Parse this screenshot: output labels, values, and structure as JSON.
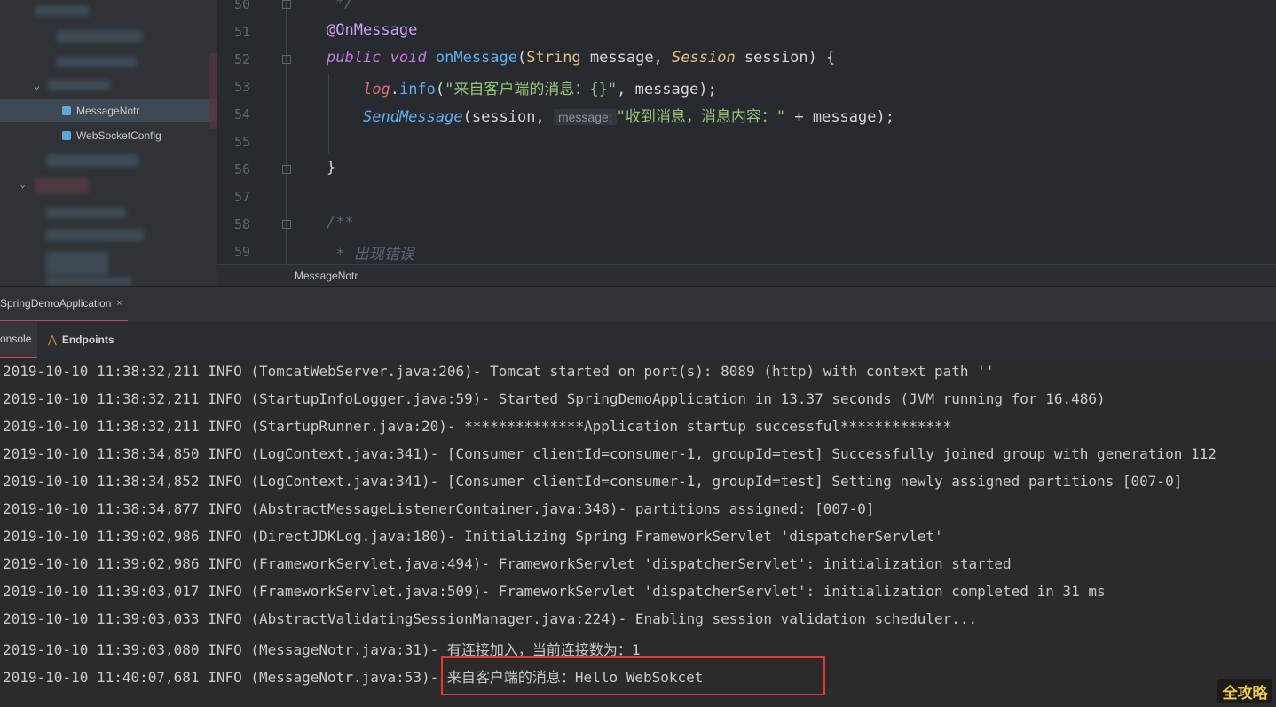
{
  "project_tree": {
    "items": [
      {
        "label": "MessageNotr",
        "selected": true
      },
      {
        "label": "WebSocketConfig",
        "selected": false
      }
    ]
  },
  "editor": {
    "line_numbers": [
      "50",
      "51",
      "52",
      "53",
      "54",
      "55",
      "56",
      "57",
      "58",
      "59"
    ],
    "lines": {
      "l50": "*/",
      "l51_annotation": "@OnMessage",
      "l52_kw1": "public",
      "l52_kw2": "void",
      "l52_fn": "onMessage",
      "l52_type1": "String",
      "l52_p1": " message, ",
      "l52_type2": "Session",
      "l52_p2": " session) {",
      "l53_var": "log",
      "l53_dot": ".",
      "l53_fn": "info",
      "l53_open": "(",
      "l53_str": "\"来自客户端的消息：{}\"",
      "l53_rest": ", message);",
      "l54_fn": "SendMessage",
      "l54_p": "(session, ",
      "l54_hint": "message:",
      "l54_str": "\"收到消息，消息内容：\"",
      "l54_rest": " + message);",
      "l56": "}",
      "l58": "/**",
      "l59": " * 出现错误"
    },
    "breadcrumb": "MessageNotr"
  },
  "run_panel": {
    "run_tab": "SpringDemoApplication",
    "close_glyph": "×",
    "tabs": {
      "console": "onsole",
      "endpoints": "Endpoints"
    }
  },
  "console": {
    "lines": [
      "2019-10-10 11:38:32,211 INFO (TomcatWebServer.java:206)- Tomcat started on port(s): 8089 (http) with context path ''",
      "2019-10-10 11:38:32,211 INFO (StartupInfoLogger.java:59)- Started SpringDemoApplication in 13.37 seconds (JVM running for 16.486)",
      "2019-10-10 11:38:32,211 INFO (StartupRunner.java:20)- **************Application startup successful*************",
      "2019-10-10 11:38:34,850 INFO (LogContext.java:341)- [Consumer clientId=consumer-1, groupId=test] Successfully joined group with generation 112",
      "2019-10-10 11:38:34,852 INFO (LogContext.java:341)- [Consumer clientId=consumer-1, groupId=test] Setting newly assigned partitions [007-0]",
      "2019-10-10 11:38:34,877 INFO (AbstractMessageListenerContainer.java:348)- partitions assigned: [007-0]",
      "2019-10-10 11:39:02,986 INFO (DirectJDKLog.java:180)- Initializing Spring FrameworkServlet 'dispatcherServlet'",
      "2019-10-10 11:39:02,986 INFO (FrameworkServlet.java:494)- FrameworkServlet 'dispatcherServlet': initialization started",
      "2019-10-10 11:39:03,017 INFO (FrameworkServlet.java:509)- FrameworkServlet 'dispatcherServlet': initialization completed in 31 ms",
      "2019-10-10 11:39:03,033 INFO (AbstractValidatingSessionManager.java:224)- Enabling session validation scheduler...",
      "2019-10-10 11:39:03,080 INFO (MessageNotr.java:31)- 有连接加入，当前连接数为：1",
      "2019-10-10 11:40:07,681 INFO (MessageNotr.java:53)- 来自客户端的消息：Hello WebSokcet"
    ]
  },
  "watermark": "全攻略",
  "colors": {
    "highlight": "#e53935",
    "accent_tab": "#d04060"
  }
}
